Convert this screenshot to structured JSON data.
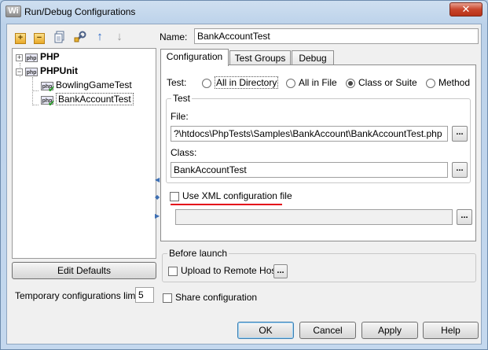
{
  "window": {
    "app_icon": "Wi",
    "title": "Run/Debug Configurations",
    "close_glyph": "✕"
  },
  "toolbar": {
    "add_glyph": "+",
    "remove_glyph": "−",
    "up_glyph": "↑",
    "down_glyph": "↓"
  },
  "tree": {
    "php_badge": "php",
    "items": [
      {
        "label": "PHP",
        "expander": "+"
      },
      {
        "label": "PHPUnit",
        "expander": "−"
      },
      {
        "label": "BowlingGameTest"
      },
      {
        "label": "BankAccountTest"
      }
    ]
  },
  "left": {
    "edit_defaults": "Edit Defaults",
    "temp_limit_label": "Temporary configurations limit:",
    "temp_limit_value": "5"
  },
  "name": {
    "label": "Name:",
    "value": "BankAccountTest"
  },
  "tabs": [
    {
      "label": "Configuration",
      "active": true
    },
    {
      "label": "Test Groups"
    },
    {
      "label": "Debug"
    }
  ],
  "config": {
    "test_label": "Test:",
    "radios": [
      {
        "label": "All in Directory",
        "checked": false
      },
      {
        "label": "All in File",
        "checked": false
      },
      {
        "label": "Class or Suite",
        "checked": true
      },
      {
        "label": "Method",
        "checked": false
      }
    ],
    "test_group_title": "Test",
    "file_label": "File:",
    "file_value": "?\\htdocs\\PhpTests\\Samples\\BankAccount\\BankAccountTest.php",
    "class_label": "Class:",
    "class_value": "BankAccountTest",
    "browse_label": "...",
    "use_xml_label": "Use XML configuration file",
    "xml_value": ""
  },
  "before_launch": {
    "title": "Before launch",
    "upload_label": "Upload to Remote Host",
    "upload_browse": "..."
  },
  "share": {
    "label": "Share configuration"
  },
  "buttons": {
    "ok": "OK",
    "cancel": "Cancel",
    "apply": "Apply",
    "help": "Help"
  },
  "colors": {
    "annotation_underline": "#e4001a",
    "check_icon": "#1c9a1c"
  }
}
